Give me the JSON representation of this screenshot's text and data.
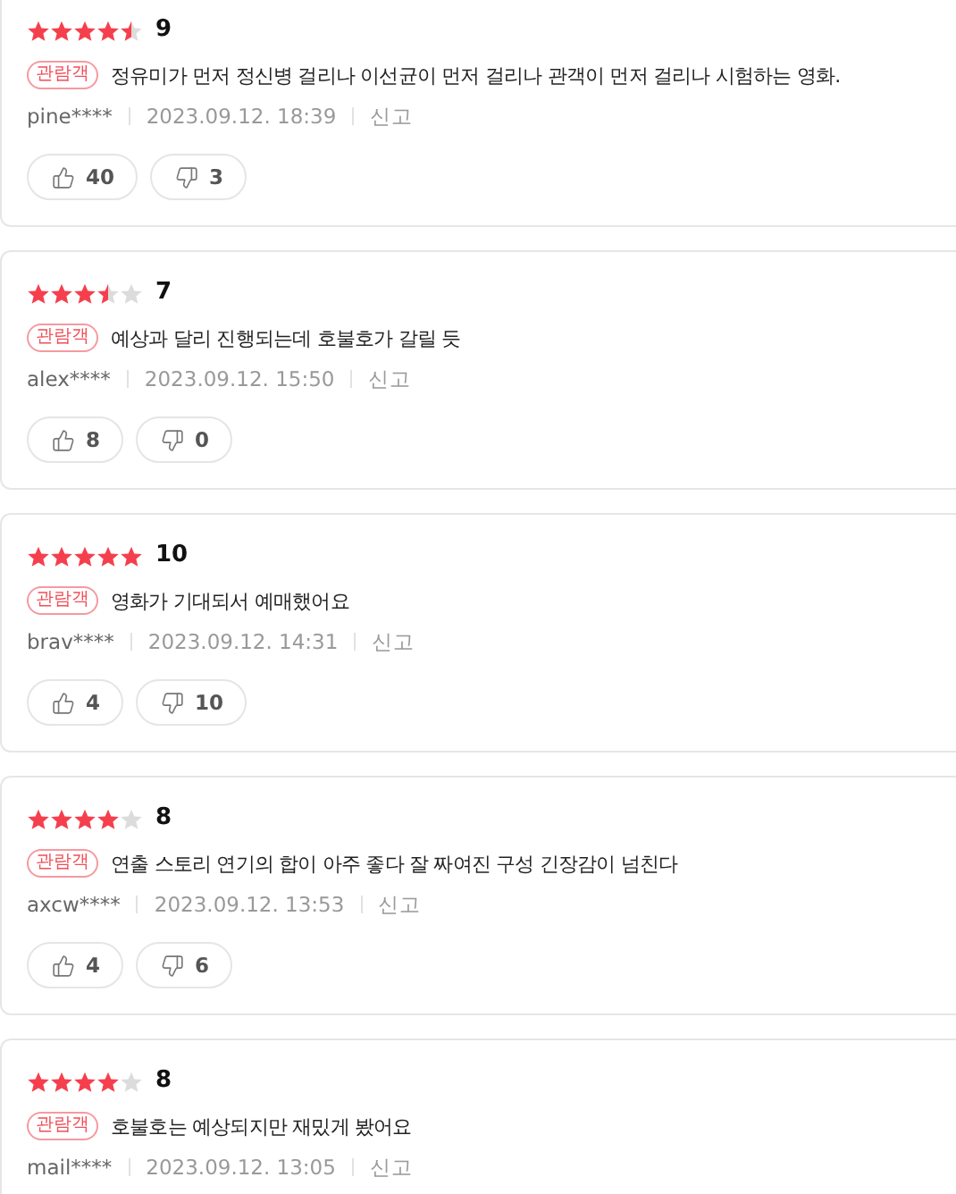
{
  "reviews": [
    {
      "stars": 4.5,
      "score": "9",
      "badge": "관람객",
      "text": "정유미가 먼저 정신병 걸리나 이선균이 먼저 걸리나 관객이 먼저 걸리나 시험하는 영화.",
      "user": "pine****",
      "date": "2023.09.12. 18:39",
      "report": "신고",
      "likes": "40",
      "dislikes": "3"
    },
    {
      "stars": 3.5,
      "score": "7",
      "badge": "관람객",
      "text": "예상과 달리 진행되는데 호불호가 갈릴 듯",
      "user": "alex****",
      "date": "2023.09.12. 15:50",
      "report": "신고",
      "likes": "8",
      "dislikes": "0"
    },
    {
      "stars": 5,
      "score": "10",
      "badge": "관람객",
      "text": "영화가 기대되서 예매했어요",
      "user": "brav****",
      "date": "2023.09.12. 14:31",
      "report": "신고",
      "likes": "4",
      "dislikes": "10"
    },
    {
      "stars": 4,
      "score": "8",
      "badge": "관람객",
      "text": "연출 스토리 연기의 합이 아주 좋다 잘 짜여진 구성 긴장감이 넘친다",
      "user": "axcw****",
      "date": "2023.09.12. 13:53",
      "report": "신고",
      "likes": "4",
      "dislikes": "6"
    },
    {
      "stars": 4,
      "score": "8",
      "badge": "관람객",
      "text": "호불호는 예상되지만 재밌게 봤어요",
      "user": "mail****",
      "date": "2023.09.12. 13:05",
      "report": "신고"
    }
  ]
}
